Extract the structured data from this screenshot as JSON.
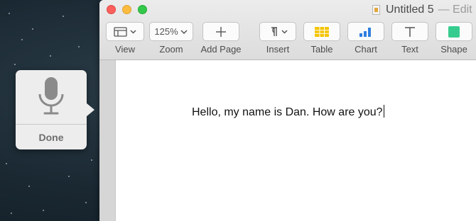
{
  "window": {
    "title": "Untitled 5",
    "title_suffix": "— Edit"
  },
  "toolbar": {
    "view_label": "View",
    "zoom_label": "Zoom",
    "zoom_value": "125%",
    "add_page_label": "Add Page",
    "insert_label": "Insert",
    "table_label": "Table",
    "chart_label": "Chart",
    "text_label": "Text",
    "shape_label": "Shape"
  },
  "document": {
    "text": "Hello, my name is Dan. How are you?"
  },
  "dictation": {
    "done_label": "Done"
  },
  "colors": {
    "table_icon": "#f5c400",
    "chart_icon": "#2f7fe0",
    "shape_icon": "#37cc8f",
    "mic_icon": "#8a8a8a"
  }
}
